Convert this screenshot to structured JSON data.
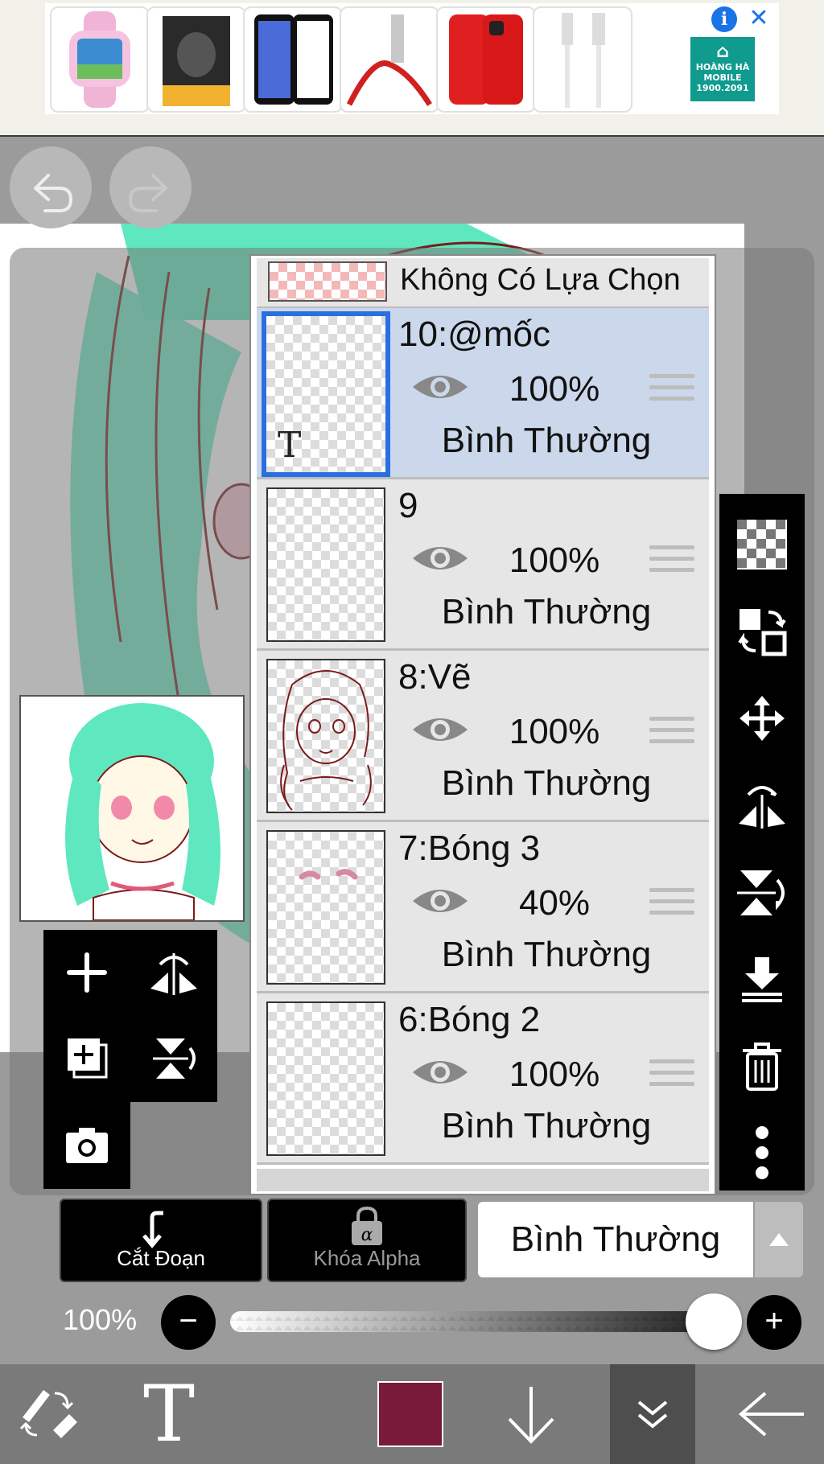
{
  "ad": {
    "info_icon": "info-icon",
    "close_icon": "close-icon",
    "logo_text": "HOÀNG HÀ MOBILE",
    "logo_phone": "1900.2091",
    "products": [
      "pink kids smartwatch",
      "screen protector box",
      "phone tempered glass",
      "red lightning cable",
      "red iPhone",
      "white usb cable"
    ]
  },
  "canvas": {
    "undo_icon": "undo-icon",
    "redo_icon": "redo-icon"
  },
  "layers": {
    "no_selection_label": "Không Có Lựa Chọn",
    "items": [
      {
        "name": "10:@mốc",
        "opacity": "100%",
        "blend": "Bình Thường",
        "selected": true,
        "has_text": true,
        "thumb_text": "T"
      },
      {
        "name": "9",
        "opacity": "100%",
        "blend": "Bình Thường",
        "selected": false
      },
      {
        "name": "8:Vẽ",
        "opacity": "100%",
        "blend": "Bình Thường",
        "selected": false
      },
      {
        "name": "7:Bóng 3",
        "opacity": "40%",
        "blend": "Bình Thường",
        "selected": false
      },
      {
        "name": "6:Bóng 2",
        "opacity": "100%",
        "blend": "Bình Thường",
        "selected": false
      }
    ]
  },
  "layer_controls": {
    "clip_label": "Cắt Đoạn",
    "alpha_lock_label": "Khóa Alpha",
    "blend_mode": "Bình Thường",
    "opacity_label": "100%",
    "opacity_value": 1.0
  },
  "bottom_bar": {
    "primary_color": "#7a1a3a",
    "selected_tool": "layer-menu"
  },
  "colors": {
    "selection_blue": "#2a6fe0",
    "selected_row": "#cbd7ea",
    "hair_mint": "#5fe8c0",
    "line_art": "#7a1a1a"
  }
}
